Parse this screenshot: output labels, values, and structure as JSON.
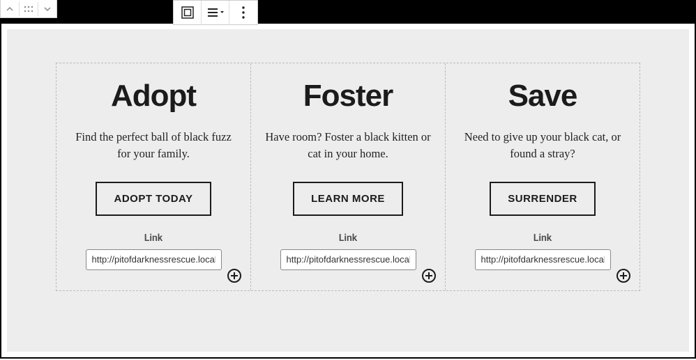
{
  "columns": [
    {
      "heading": "Adopt",
      "desc": "Find the perfect ball of black fuzz for your family.",
      "button": "ADOPT TODAY",
      "linkLabel": "Link",
      "linkValue": "http://pitofdarknessrescue.local/"
    },
    {
      "heading": "Foster",
      "desc": "Have room? Foster a black kitten or cat in your home.",
      "button": "LEARN MORE",
      "linkLabel": "Link",
      "linkValue": "http://pitofdarknessrescue.local/"
    },
    {
      "heading": "Save",
      "desc": "Need to give up your black cat, or found a stray?",
      "button": "SURRENDER",
      "linkLabel": "Link",
      "linkValue": "http://pitofdarknessrescue.local/"
    }
  ]
}
